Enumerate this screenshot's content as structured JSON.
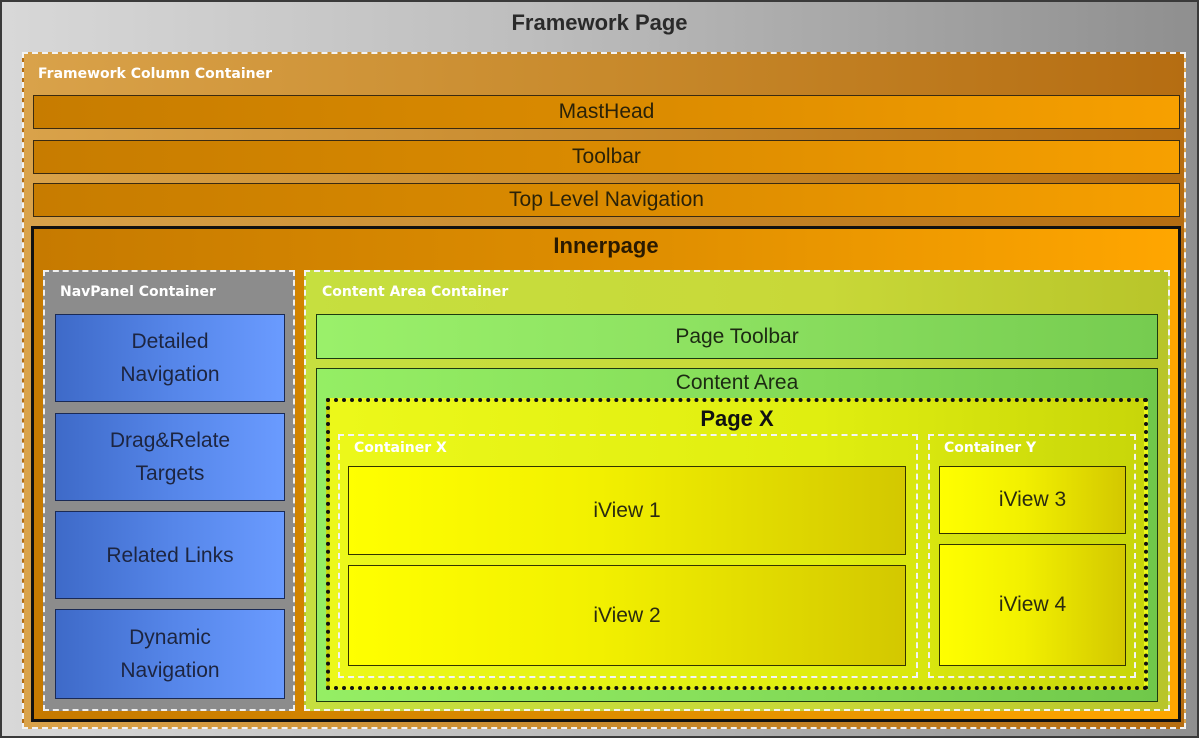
{
  "framework_page": {
    "title": "Framework Page"
  },
  "framework_column_container": {
    "title": "Framework Column Container"
  },
  "bars": {
    "masthead": "MastHead",
    "toolbar": "Toolbar",
    "top_level_navigation": "Top Level Navigation"
  },
  "innerpage": {
    "title": "Innerpage"
  },
  "navpanel": {
    "title": "NavPanel Container",
    "items": [
      {
        "line1": "Detailed",
        "line2": "Navigation"
      },
      {
        "line1": "Drag&Relate",
        "line2": "Targets"
      },
      {
        "line1": "Related Links",
        "line2": ""
      },
      {
        "line1": "Dynamic",
        "line2": "Navigation"
      }
    ]
  },
  "content_area_container": {
    "title": "Content Area Container",
    "page_toolbar": "Page Toolbar",
    "content_area": "Content Area",
    "page_x": "Page X",
    "container_x": "Container X",
    "container_y": "Container Y",
    "iviews": [
      "iView 1",
      "iView 2",
      "iView 3",
      "iView 4"
    ]
  },
  "colors": {
    "framework_page": "#bdbdbd",
    "framework_column": "#c88a2c",
    "orange_bars": "#dc8c00",
    "navpanel": "#8c8c8c",
    "nav_items": "#5585e8",
    "content_area_container": "#c6df3f",
    "content_area": "#86de5a",
    "page_x": "#e0ee10",
    "iview": "#f2f000"
  }
}
